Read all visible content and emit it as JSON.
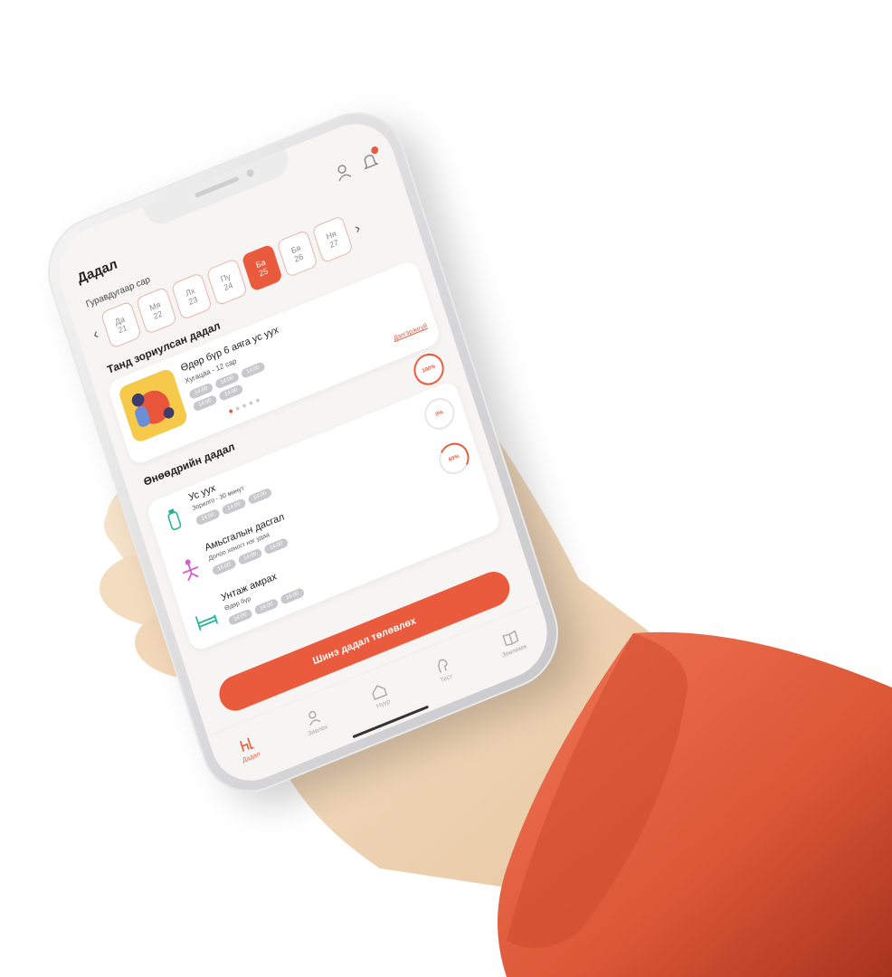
{
  "header": {
    "title": "Дадал"
  },
  "calendar": {
    "month": "Гуравдугаар сар",
    "days": [
      {
        "wd": "Да",
        "d": "21"
      },
      {
        "wd": "Мя",
        "d": "22"
      },
      {
        "wd": "Лх",
        "d": "23"
      },
      {
        "wd": "Пү",
        "d": "24"
      },
      {
        "wd": "Ба",
        "d": "25"
      },
      {
        "wd": "Бя",
        "d": "26"
      },
      {
        "wd": "Ня",
        "d": "27"
      }
    ],
    "active_index": 4
  },
  "featured": {
    "section_title": "Танд зориулсан дадал",
    "title": "Өдөр бүр 6 аяга ус уух",
    "subtitle": "Хугацаа - 12 сар",
    "chips": [
      "14:00",
      "14:00",
      "14:00",
      "14:00",
      "14:00"
    ],
    "detail_link": "Дэлгэрэнгүй"
  },
  "today": {
    "section_title": "Өнөөдрийн дадал",
    "overall_progress": "100%",
    "tasks": [
      {
        "title": "Ус уух",
        "subtitle": "Зорилго - 30 минут",
        "chips": [
          "14:00",
          "14:00",
          "14:00"
        ],
        "progress": "0%",
        "icon": "water-bottle-icon"
      },
      {
        "title": "Амьсгалын дасгал",
        "subtitle": "Долоо хоногт нэг удаа",
        "chips": [
          "14:00",
          "14:00",
          "14:00"
        ],
        "progress": "60%",
        "icon": "yoga-icon"
      },
      {
        "title": "Унтаж амрах",
        "subtitle": "Өдөр бүр",
        "chips": [
          "14:00",
          "14:00",
          "14:00"
        ],
        "progress": "",
        "icon": "bed-icon"
      }
    ]
  },
  "cta": {
    "label": "Шинэ дадал төлөвлөх"
  },
  "tabs": [
    {
      "label": "Дадал",
      "icon": "habit-icon",
      "active": true
    },
    {
      "label": "Зөвлөх",
      "icon": "advisor-icon",
      "active": false
    },
    {
      "label": "Нүүр",
      "icon": "home-icon",
      "active": false
    },
    {
      "label": "Тест",
      "icon": "test-icon",
      "active": false
    },
    {
      "label": "Зөвлөмж",
      "icon": "book-icon",
      "active": false
    }
  ],
  "colors": {
    "accent": "#ea5a3d",
    "sleeve": "#e3603f",
    "skin": "#f3dcc0"
  }
}
